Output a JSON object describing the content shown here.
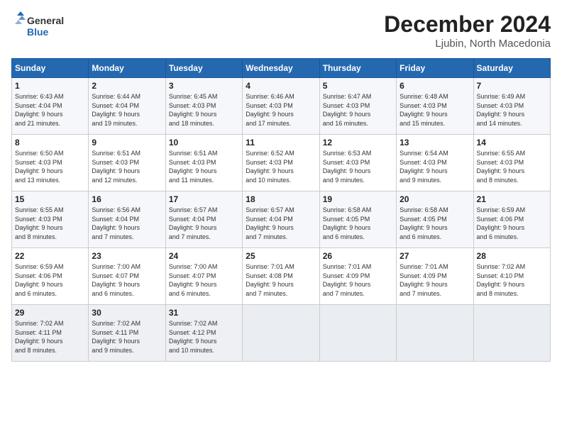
{
  "header": {
    "logo_line1": "General",
    "logo_line2": "Blue",
    "month": "December 2024",
    "location": "Ljubin, North Macedonia"
  },
  "weekdays": [
    "Sunday",
    "Monday",
    "Tuesday",
    "Wednesday",
    "Thursday",
    "Friday",
    "Saturday"
  ],
  "weeks": [
    [
      {
        "day": "1",
        "info": "Sunrise: 6:43 AM\nSunset: 4:04 PM\nDaylight: 9 hours\nand 21 minutes."
      },
      {
        "day": "2",
        "info": "Sunrise: 6:44 AM\nSunset: 4:04 PM\nDaylight: 9 hours\nand 19 minutes."
      },
      {
        "day": "3",
        "info": "Sunrise: 6:45 AM\nSunset: 4:03 PM\nDaylight: 9 hours\nand 18 minutes."
      },
      {
        "day": "4",
        "info": "Sunrise: 6:46 AM\nSunset: 4:03 PM\nDaylight: 9 hours\nand 17 minutes."
      },
      {
        "day": "5",
        "info": "Sunrise: 6:47 AM\nSunset: 4:03 PM\nDaylight: 9 hours\nand 16 minutes."
      },
      {
        "day": "6",
        "info": "Sunrise: 6:48 AM\nSunset: 4:03 PM\nDaylight: 9 hours\nand 15 minutes."
      },
      {
        "day": "7",
        "info": "Sunrise: 6:49 AM\nSunset: 4:03 PM\nDaylight: 9 hours\nand 14 minutes."
      }
    ],
    [
      {
        "day": "8",
        "info": "Sunrise: 6:50 AM\nSunset: 4:03 PM\nDaylight: 9 hours\nand 13 minutes."
      },
      {
        "day": "9",
        "info": "Sunrise: 6:51 AM\nSunset: 4:03 PM\nDaylight: 9 hours\nand 12 minutes."
      },
      {
        "day": "10",
        "info": "Sunrise: 6:51 AM\nSunset: 4:03 PM\nDaylight: 9 hours\nand 11 minutes."
      },
      {
        "day": "11",
        "info": "Sunrise: 6:52 AM\nSunset: 4:03 PM\nDaylight: 9 hours\nand 10 minutes."
      },
      {
        "day": "12",
        "info": "Sunrise: 6:53 AM\nSunset: 4:03 PM\nDaylight: 9 hours\nand 9 minutes."
      },
      {
        "day": "13",
        "info": "Sunrise: 6:54 AM\nSunset: 4:03 PM\nDaylight: 9 hours\nand 9 minutes."
      },
      {
        "day": "14",
        "info": "Sunrise: 6:55 AM\nSunset: 4:03 PM\nDaylight: 9 hours\nand 8 minutes."
      }
    ],
    [
      {
        "day": "15",
        "info": "Sunrise: 6:55 AM\nSunset: 4:03 PM\nDaylight: 9 hours\nand 8 minutes."
      },
      {
        "day": "16",
        "info": "Sunrise: 6:56 AM\nSunset: 4:04 PM\nDaylight: 9 hours\nand 7 minutes."
      },
      {
        "day": "17",
        "info": "Sunrise: 6:57 AM\nSunset: 4:04 PM\nDaylight: 9 hours\nand 7 minutes."
      },
      {
        "day": "18",
        "info": "Sunrise: 6:57 AM\nSunset: 4:04 PM\nDaylight: 9 hours\nand 7 minutes."
      },
      {
        "day": "19",
        "info": "Sunrise: 6:58 AM\nSunset: 4:05 PM\nDaylight: 9 hours\nand 6 minutes."
      },
      {
        "day": "20",
        "info": "Sunrise: 6:58 AM\nSunset: 4:05 PM\nDaylight: 9 hours\nand 6 minutes."
      },
      {
        "day": "21",
        "info": "Sunrise: 6:59 AM\nSunset: 4:06 PM\nDaylight: 9 hours\nand 6 minutes."
      }
    ],
    [
      {
        "day": "22",
        "info": "Sunrise: 6:59 AM\nSunset: 4:06 PM\nDaylight: 9 hours\nand 6 minutes."
      },
      {
        "day": "23",
        "info": "Sunrise: 7:00 AM\nSunset: 4:07 PM\nDaylight: 9 hours\nand 6 minutes."
      },
      {
        "day": "24",
        "info": "Sunrise: 7:00 AM\nSunset: 4:07 PM\nDaylight: 9 hours\nand 6 minutes."
      },
      {
        "day": "25",
        "info": "Sunrise: 7:01 AM\nSunset: 4:08 PM\nDaylight: 9 hours\nand 7 minutes."
      },
      {
        "day": "26",
        "info": "Sunrise: 7:01 AM\nSunset: 4:09 PM\nDaylight: 9 hours\nand 7 minutes."
      },
      {
        "day": "27",
        "info": "Sunrise: 7:01 AM\nSunset: 4:09 PM\nDaylight: 9 hours\nand 7 minutes."
      },
      {
        "day": "28",
        "info": "Sunrise: 7:02 AM\nSunset: 4:10 PM\nDaylight: 9 hours\nand 8 minutes."
      }
    ],
    [
      {
        "day": "29",
        "info": "Sunrise: 7:02 AM\nSunset: 4:11 PM\nDaylight: 9 hours\nand 8 minutes."
      },
      {
        "day": "30",
        "info": "Sunrise: 7:02 AM\nSunset: 4:11 PM\nDaylight: 9 hours\nand 9 minutes."
      },
      {
        "day": "31",
        "info": "Sunrise: 7:02 AM\nSunset: 4:12 PM\nDaylight: 9 hours\nand 10 minutes."
      },
      {
        "day": "",
        "info": ""
      },
      {
        "day": "",
        "info": ""
      },
      {
        "day": "",
        "info": ""
      },
      {
        "day": "",
        "info": ""
      }
    ]
  ]
}
